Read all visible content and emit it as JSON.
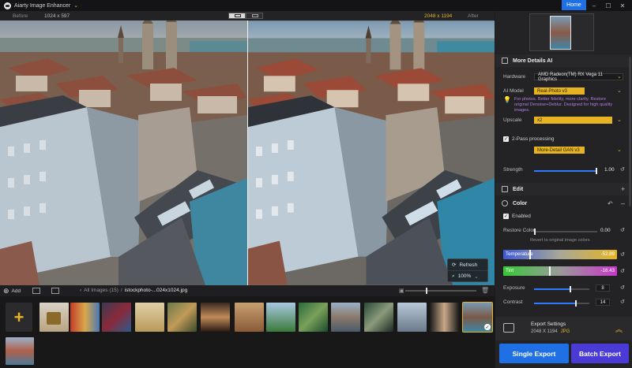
{
  "app": {
    "title": "Aiarty Image Enhancer",
    "home_label": "Home"
  },
  "window_controls": {
    "minimize": "–",
    "maximize": "☐",
    "close": "✕"
  },
  "compare": {
    "before_label": "Before",
    "before_size": "1024 x 597",
    "after_size": "2048 x 1194",
    "after_label": "After"
  },
  "viewer": {
    "refresh_label": "Refresh",
    "zoom": "100%"
  },
  "browser": {
    "add_label": "Add",
    "crumb_root": "All Images (15)",
    "crumb_sep": "/",
    "crumb_file": "istockphoto-...024x1024.jpg"
  },
  "panel": {
    "section_title": "More Details AI",
    "hardware_label": "Hardware",
    "hardware_value": "AMD Radeon(TM) RX Vega 11 Graphics",
    "model_label": "AI Model",
    "model_value": "Real-Photo  v3",
    "model_note": "For photos. Better fidelity, more clarity. Restore original Denoise+Deblur. Designed for high quality images.",
    "upscale_label": "Upscale",
    "upscale_value": "x2",
    "twopass_label": "2-Pass processing",
    "twopass_value": "More-Detail GAN  v3",
    "strength_label": "Strength",
    "strength_value": "1.00",
    "strength_level": 0.97,
    "edit_title": "Edit",
    "color_title": "Color",
    "enabled_label": "Enabled",
    "restore_label": "Restore Color",
    "restore_value": "0.00",
    "restore_hint": "Revert to original image colors",
    "temperature_label": "Temperature",
    "temperature_value": "-52.89",
    "tint_label": "Tint",
    "tint_value": "-16.43",
    "exposure_label": "Exposure",
    "exposure_value": "8",
    "contrast_label": "Contrast",
    "contrast_value": "14",
    "export_title": "Export Settings",
    "export_size": "2048 X 1194",
    "export_format": "JPG",
    "single_export": "Single Export",
    "batch_export": "Batch Export"
  },
  "colors": {
    "accent_gold": "#e6b422",
    "primary_blue": "#1f6fe5",
    "batch_purple": "#4a3ad6"
  },
  "icons": [
    "app-logo-icon",
    "chevron-down-icon",
    "add-icon",
    "grid-view-icon",
    "refresh-icon",
    "zoom-icon",
    "trash-icon",
    "check-icon",
    "reset-icon",
    "export-icon",
    "chevron-up-icon"
  ]
}
